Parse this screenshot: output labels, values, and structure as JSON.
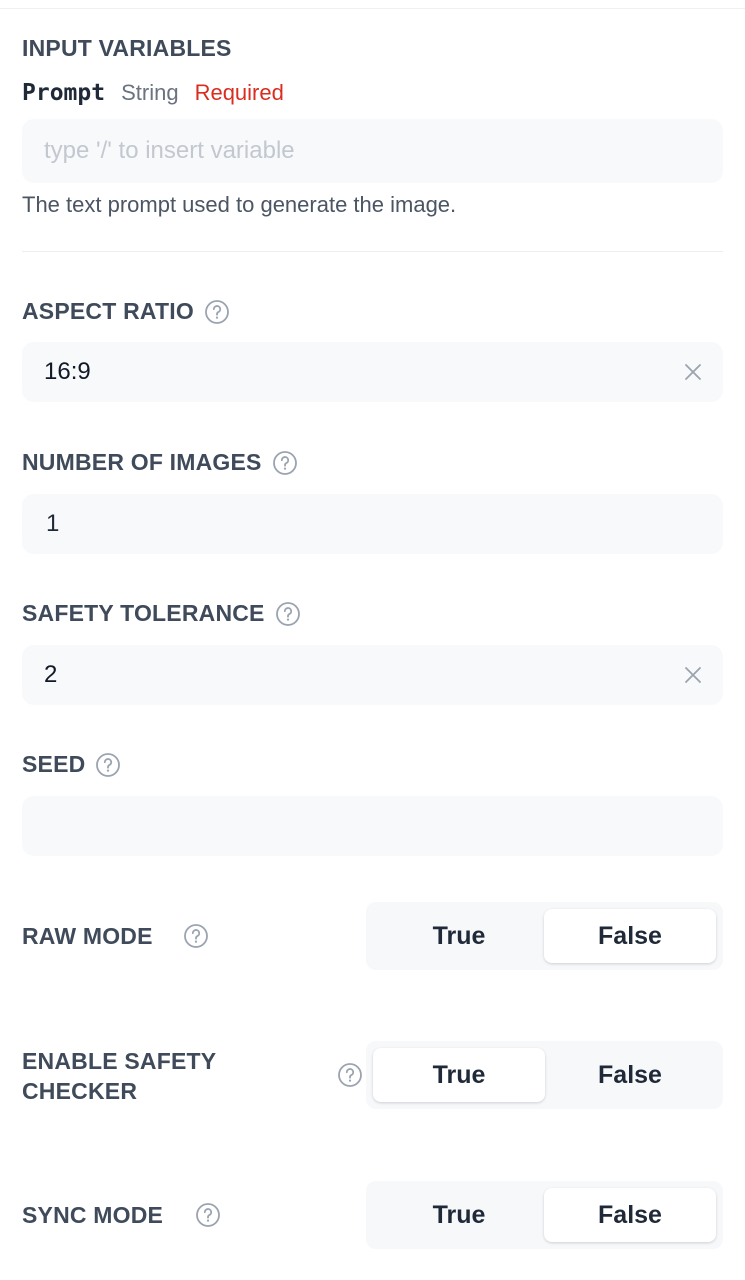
{
  "input_variables": {
    "section_title": "INPUT VARIABLES",
    "prompt": {
      "name": "Prompt",
      "type": "String",
      "required": "Required",
      "placeholder": "type '/' to insert variable",
      "value": "",
      "help": "The text prompt used to generate the image."
    }
  },
  "aspect_ratio": {
    "label": "ASPECT RATIO",
    "value": "16:9",
    "help_icon": "question-circle-icon",
    "clear_icon": "close-icon"
  },
  "number_of_images": {
    "label": "NUMBER OF IMAGES",
    "value": "1",
    "help_icon": "question-circle-icon"
  },
  "safety_tolerance": {
    "label": "SAFETY TOLERANCE",
    "value": "2",
    "help_icon": "question-circle-icon",
    "clear_icon": "close-icon"
  },
  "seed": {
    "label": "SEED",
    "value": "",
    "help_icon": "question-circle-icon"
  },
  "raw_mode": {
    "label": "RAW MODE",
    "true_label": "True",
    "false_label": "False",
    "selected": "False"
  },
  "enable_safety_checker": {
    "label_line1": "ENABLE SAFETY",
    "label_line2": "CHECKER",
    "true_label": "True",
    "false_label": "False",
    "selected": "True"
  },
  "sync_mode": {
    "label": "SYNC MODE",
    "true_label": "True",
    "false_label": "False",
    "selected": "False"
  },
  "colors": {
    "required": "#d92d20",
    "label": "#3f4a5a",
    "field_bg": "#f8f9fb",
    "toggle_bg": "#f7f8fa"
  }
}
